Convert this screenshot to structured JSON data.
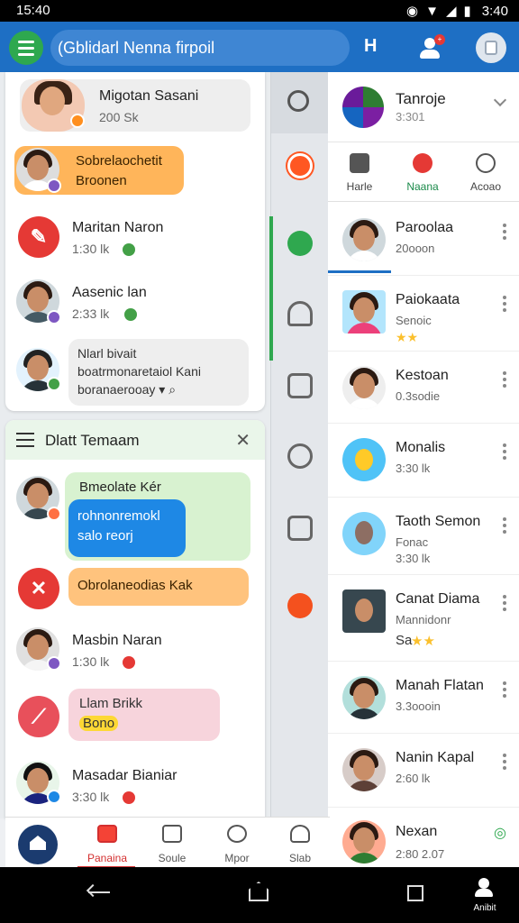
{
  "status_bar": {
    "time": "15:40",
    "clock": "3:40"
  },
  "app_bar": {
    "search_text": "(Gblidarl Nenna firpoil",
    "h_label": "H"
  },
  "left_panel_1": {
    "items": [
      {
        "name": "Migotan Sasani",
        "sub": "200 Sk"
      },
      {
        "bubble": "Sobrelaochetit",
        "bubble2": "Broonen"
      },
      {
        "name": "Maritan Naron",
        "sub": "1:30 lk"
      },
      {
        "name": "Aasenic lan",
        "sub": "2:33 lk"
      },
      {
        "line1": "Nlarl bivait",
        "line2": "boatrmonaretaiol Kani",
        "line3": "boranaerooay"
      }
    ]
  },
  "left_panel_2": {
    "title": "Dlatt Temaam",
    "items": [
      {
        "bubble_top": "Bmeolate Kér",
        "bubble_blue_1": "rohnonremokl",
        "bubble_blue_2": "salo reorj"
      },
      {
        "bubble": "Obrolaneodias Kak"
      },
      {
        "name": "Masbin Naran",
        "sub": "1:30 lk"
      },
      {
        "bubble_top": "Llam Brikk",
        "bubble_bottom": "Bono"
      },
      {
        "name": "Masadar Bianiar",
        "sub": "3:30 lk"
      }
    ]
  },
  "bottom_nav": {
    "items": [
      {
        "label": "Panaina"
      },
      {
        "label": "Soule"
      },
      {
        "label": "Mpor"
      },
      {
        "label": "Slab"
      }
    ]
  },
  "right_panel": {
    "group_title": "Tanroje",
    "group_sub": "3:301",
    "tabs": [
      {
        "label": "Harle"
      },
      {
        "label": "Naana"
      },
      {
        "label": "Acoao"
      }
    ],
    "contacts": [
      {
        "name": "Paroolaa",
        "sub": "20ooon"
      },
      {
        "name": "Paiokaata",
        "sub": "Senoic"
      },
      {
        "name": "Kestoan",
        "sub": "0.3sodie"
      },
      {
        "name": "Monalis",
        "sub": "3:30 lk"
      },
      {
        "name": "Taoth Semon",
        "sub": "Fonac"
      },
      {
        "name": "Canat Diama",
        "sub": "Mannidonr"
      },
      {
        "name": "Manah Flatan",
        "sub": "3.3oooin"
      },
      {
        "name": "Nanin Kapal",
        "sub": "2:60 lk"
      },
      {
        "name": "Nexan",
        "sub": "2:80 2.07"
      }
    ],
    "contact_sub_extra": {
      "canat_sub2": "Sa",
      "tanth_time": "3:30 lk"
    }
  },
  "system_nav": {
    "user_label": "Anibit"
  },
  "colors": {
    "app_bar": "#1e6fc4",
    "accent_green": "#2fa84f",
    "accent_red": "#e53935"
  }
}
